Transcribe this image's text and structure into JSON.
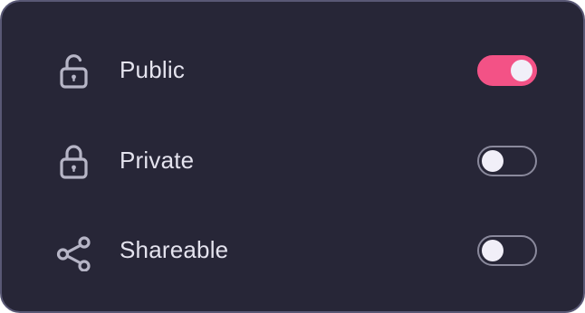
{
  "settings": {
    "items": [
      {
        "label": "Public",
        "icon": "lock-open-icon",
        "enabled": true
      },
      {
        "label": "Private",
        "icon": "lock-icon",
        "enabled": false
      },
      {
        "label": "Shareable",
        "icon": "share-icon",
        "enabled": false
      }
    ]
  },
  "colors": {
    "card_background": "#272637",
    "card_border": "#595875",
    "text": "#e4e3ee",
    "icon": "#b6b5c6",
    "toggle_on": "#f35286",
    "toggle_off_border": "#8a899c",
    "knob": "#f1eff8"
  }
}
